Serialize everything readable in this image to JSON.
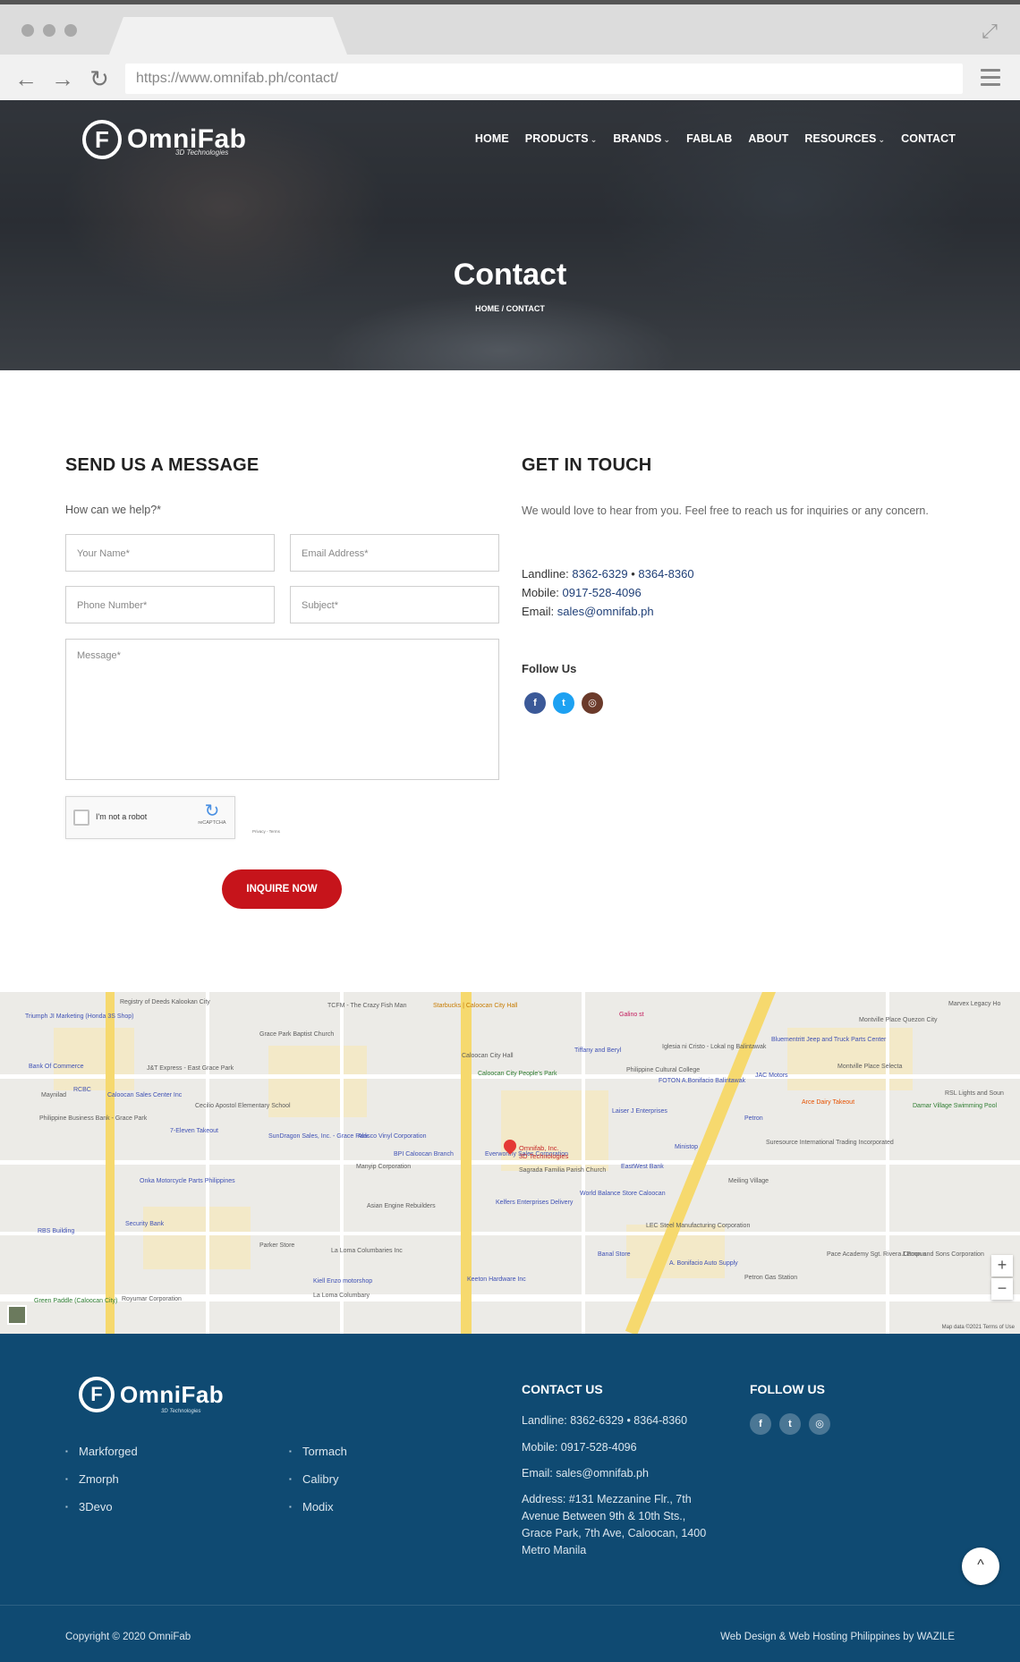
{
  "browser": {
    "url": "https://www.omnifab.ph/contact/",
    "icons": [
      "back-icon",
      "forward-icon",
      "reload-icon",
      "menu-icon",
      "expand-icon"
    ]
  },
  "site": {
    "logo_text": "OmniFab",
    "logo_mark": "F",
    "logo_sub": "3D Technologies"
  },
  "nav": {
    "items": [
      {
        "label": "HOME"
      },
      {
        "label": "PRODUCTS",
        "dropdown": true
      },
      {
        "label": "BRANDS",
        "dropdown": true
      },
      {
        "label": "FABLAB"
      },
      {
        "label": "ABOUT"
      },
      {
        "label": "RESOURCES",
        "dropdown": true
      },
      {
        "label": "CONTACT"
      }
    ]
  },
  "hero": {
    "title": "Contact",
    "breadcrumb": "HOME  /  CONTACT"
  },
  "form": {
    "heading": "SEND US A MESSAGE",
    "help_text": "How can we help?*",
    "name_placeholder": "Your Name*",
    "email_placeholder": "Email Address*",
    "phone_placeholder": "Phone Number*",
    "subject_placeholder": "Subject*",
    "message_placeholder": "Message*",
    "captcha_label": "I'm not a robot",
    "captcha_brand": "reCAPTCHA",
    "captcha_terms": "Privacy - Terms",
    "submit_label": "INQUIRE NOW"
  },
  "contact": {
    "heading": "GET IN TOUCH",
    "intro": "We would love to hear from you. Feel free to reach us for inquiries or any concern.",
    "landline_label": "Landline:",
    "landline_1": "8362-6329",
    "landline_sep": "•",
    "landline_2": "8364-8360",
    "mobile_label": "Mobile:",
    "mobile": "0917-528-4096",
    "email_label": "Email:",
    "email": "sales@omnifab.ph",
    "follow_label": "Follow Us",
    "social": [
      {
        "icon": "facebook-icon",
        "glyph": "f",
        "color": "#3b5998"
      },
      {
        "icon": "twitter-icon",
        "glyph": "t",
        "color": "#1da1f2"
      },
      {
        "icon": "instagram-icon",
        "glyph": "◎",
        "color": "#6b3a2a"
      }
    ]
  },
  "map": {
    "pin_label": "Omnifab, Inc.",
    "pin_sublabel": "3D Technologies",
    "labels": [
      "Registry of Deeds Kalookan City",
      "TCFM - The Crazy Fish Man",
      "Starbucks | Caloocan City Hall",
      "Galino st",
      "Triumph JI Marketing (Honda 3S Shop)",
      "Grace Park Baptist Church",
      "Caloocan City Hall",
      "Bank Of Commerce",
      "J&T Express - East Grace Park",
      "Tiffany and Beryl",
      "Iglesia ni Cristo - Lokal ng Balintawak",
      "Philippine Cultural College",
      "Bluementritt Jeep and Truck Parts Center",
      "Montville Place Quezon City",
      "Marvex Legacy Ho",
      "Caloocan City People's Park",
      "JAC Motors",
      "FOTON A.Bonifacio Balintawak",
      "Montville Place Selecta",
      "Maynilad",
      "RCBC",
      "Caloocan Sales Center Inc",
      "Cecilio Apostol Elementary School",
      "Arce Dairy Takeout",
      "Damar Village Swimming Pool",
      "RSL Lights and Soun",
      "Philippine Business Bank - Grace Park",
      "7-Eleven Takeout",
      "SunDragon Sales, Inc. - Grace Park",
      "Alasco Vinyl Corporation",
      "Laiser J Enterprises",
      "Petron",
      "Suresource International Trading Incorporated",
      "BPI Caloocan Branch",
      "Everworthy Sales Corporation",
      "Sagrada Familia Parish Church",
      "EastWest Bank",
      "Ministop",
      "Manyip Corporation",
      "Meiling Village",
      "Onka Motorcycle Parts Philippines",
      "Asian Engine Rebuilders",
      "Kelfers Enterprises Delivery",
      "World Balance Store Caloocan",
      "Security Bank",
      "RBS Building",
      "Parker Store",
      "LEC Steel Manufacturing Corporation",
      "La Loma Columbaries Inc",
      "Banal Store",
      "A. Bonifacio Auto Supply",
      "Pace Academy Sgt. Rivera Campus",
      "J.Poon and Sons Corporation",
      "Petron Gas Station",
      "Kiell Enzo motorshop",
      "Keeton Hardware Inc",
      "Green Paddle (Caloocan City)",
      "Royumar Corporation",
      "La Loma Columbary",
      "Map data ©2021",
      "Terms of Use"
    ],
    "zoom_in": "+",
    "zoom_out": "−",
    "credit": "Map data ©2021   Terms of Use"
  },
  "footer": {
    "links_col1": [
      "Markforged",
      "Zmorph",
      "3Devo"
    ],
    "links_col2": [
      "Tormach",
      "Calibry",
      "Modix"
    ],
    "contact_heading": "CONTACT US",
    "landline": "Landline: 8362-6329 • 8364-8360",
    "mobile": "Mobile: 0917-528-4096",
    "email": "Email: sales@omnifab.ph",
    "address_lines": [
      "Address: #131 Mezzanine Flr., 7th",
      "Avenue Between 9th & 10th Sts.,",
      "Grace Park, 7th Ave, Caloocan, 1400",
      "Metro Manila"
    ],
    "follow_heading": "FOLLOW US",
    "social_glyphs": [
      "f",
      "t",
      "◎"
    ],
    "copyright": "Copyright © 2020 OmniFab",
    "credit": "Web Design & Web Hosting Philippines by WAZILE",
    "back_to_top": "^"
  }
}
